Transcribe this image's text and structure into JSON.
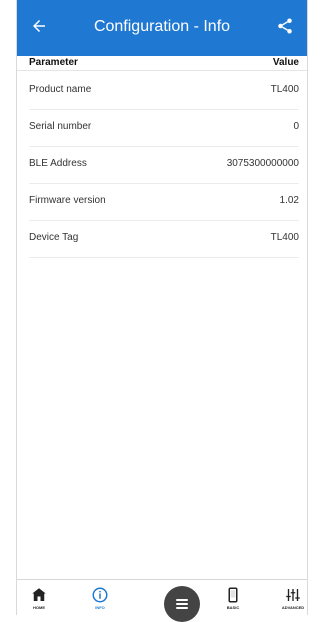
{
  "header": {
    "title": "Configuration - Info",
    "back_icon": "arrow-left-icon",
    "share_icon": "share-icon"
  },
  "table": {
    "header": {
      "parameter": "Parameter",
      "value": "Value"
    },
    "rows": [
      {
        "name": "Product name",
        "value": "TL400"
      },
      {
        "name": "Serial number",
        "value": "0"
      },
      {
        "name": "BLE Address",
        "value": "3075300000000"
      },
      {
        "name": "Firmware version",
        "value": "1.02"
      },
      {
        "name": "Device Tag",
        "value": "TL400"
      }
    ]
  },
  "bottom_nav": {
    "home": {
      "label": "HOME",
      "icon": "home-icon"
    },
    "info": {
      "label": "INFO",
      "icon": "info-icon"
    },
    "menu": {
      "icon": "menu-icon"
    },
    "basic": {
      "label": "BASIC",
      "icon": "device-icon"
    },
    "advanced": {
      "label": "ADVANCED",
      "icon": "sliders-icon"
    }
  },
  "colors": {
    "header_bg": "#1f78d1",
    "active_nav": "#1f78d1",
    "fab_bg": "#444444"
  }
}
